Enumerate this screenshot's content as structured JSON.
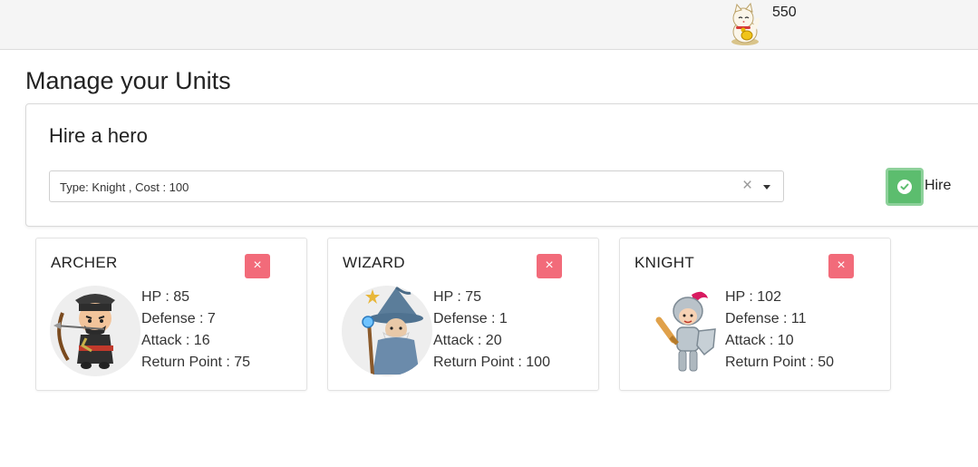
{
  "header": {
    "coins": "550",
    "avatar_icon": "lucky-cat-icon"
  },
  "page_title": "Manage your Units",
  "hire_panel": {
    "title": "Hire a hero",
    "selected": "Type: Knight , Cost : 100",
    "clear_symbol": "×",
    "button_label": "Hire",
    "button_color": "#5cbd6e"
  },
  "units": [
    {
      "name": "ARCHER",
      "icon": "archer-icon",
      "remove_symbol": "×",
      "hp": "HP : 85",
      "defense": "Defense : 7",
      "attack": "Attack : 16",
      "return_point": "Return Point : 75"
    },
    {
      "name": "WIZARD",
      "icon": "wizard-icon",
      "remove_symbol": "×",
      "hp": "HP : 75",
      "defense": "Defense : 1",
      "attack": "Attack : 20",
      "return_point": "Return Point : 100"
    },
    {
      "name": "KNIGHT",
      "icon": "knight-icon",
      "remove_symbol": "×",
      "hp": "HP : 102",
      "defense": "Defense : 11",
      "attack": "Attack : 10",
      "return_point": "Return Point : 50"
    }
  ],
  "colors": {
    "remove_button": "#f26b7a",
    "hire_button": "#5cbd6e"
  }
}
